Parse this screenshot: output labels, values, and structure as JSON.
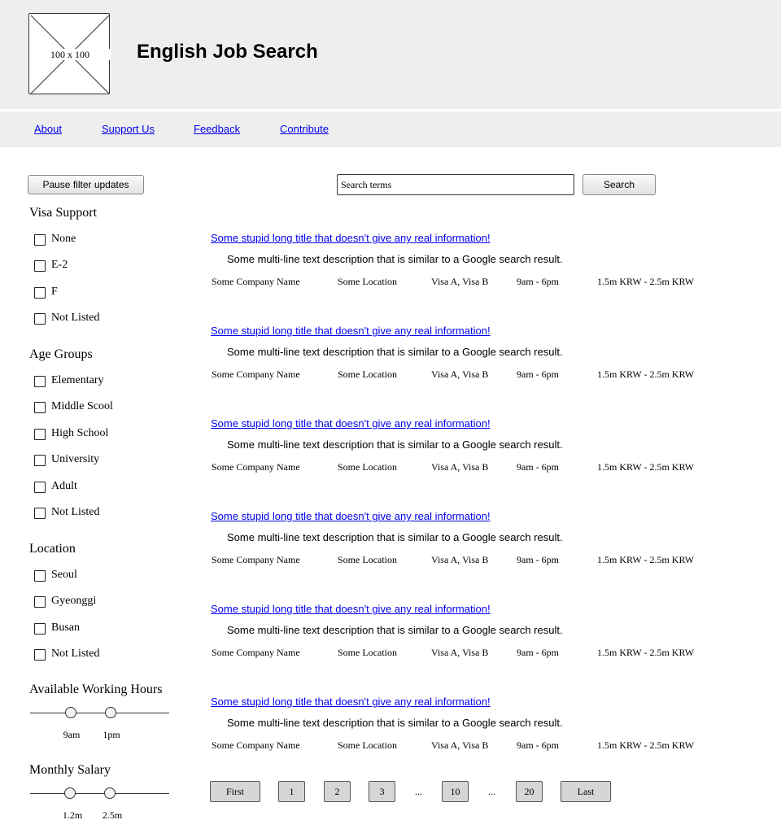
{
  "header": {
    "logo_placeholder": "100 x 100",
    "title": "English Job Search"
  },
  "nav": {
    "links": [
      "About",
      "Support Us",
      "Feedback",
      "Contribute"
    ]
  },
  "sidebar": {
    "pause_button": "Pause filter updates",
    "visa": {
      "title": "Visa Support",
      "options": [
        "None",
        "E-2",
        "F",
        "Not Listed"
      ]
    },
    "age": {
      "title": "Age Groups",
      "options": [
        "Elementary",
        "Middle Scool",
        "High School",
        "University",
        "Adult",
        "Not Listed"
      ]
    },
    "location": {
      "title": "Location",
      "options": [
        "Seoul",
        "Gyeonggi",
        "Busan",
        "Not Listed"
      ]
    },
    "hours": {
      "title": "Available Working Hours",
      "low_label": "9am",
      "high_label": "1pm"
    },
    "salary": {
      "title": "Monthly Salary",
      "low_label": "1.2m",
      "high_label": "2.5m"
    }
  },
  "search": {
    "value": "Search terms",
    "button": "Search"
  },
  "results": [
    {
      "title": "Some stupid long title that doesn't give any real information!",
      "description": "Some multi-line text description that is similar to a Google search result.",
      "company": "Some Company Name",
      "location": "Some Location",
      "visa": "Visa A, Visa B",
      "hours": "9am - 6pm",
      "salary": "1.5m KRW - 2.5m KRW"
    },
    {
      "title": "Some stupid long title that doesn't give any real information!",
      "description": "Some multi-line text description that is similar to a Google search result.",
      "company": "Some Company Name",
      "location": "Some Location",
      "visa": "Visa A, Visa B",
      "hours": "9am - 6pm",
      "salary": "1.5m KRW - 2.5m KRW"
    },
    {
      "title": "Some stupid long title that doesn't give any real information!",
      "description": "Some multi-line text description that is similar to a Google search result.",
      "company": "Some Company Name",
      "location": "Some Location",
      "visa": "Visa A, Visa B",
      "hours": "9am - 6pm",
      "salary": "1.5m KRW - 2.5m KRW"
    },
    {
      "title": "Some stupid long title that doesn't give any real information!",
      "description": "Some multi-line text description that is similar to a Google search result.",
      "company": "Some Company Name",
      "location": "Some Location",
      "visa": "Visa A, Visa B",
      "hours": "9am - 6pm",
      "salary": "1.5m KRW - 2.5m KRW"
    },
    {
      "title": "Some stupid long title that doesn't give any real information!",
      "description": "Some multi-line text description that is similar to a Google search result.",
      "company": "Some Company Name",
      "location": "Some Location",
      "visa": "Visa A, Visa B",
      "hours": "9am - 6pm",
      "salary": "1.5m KRW - 2.5m KRW"
    },
    {
      "title": "Some stupid long title that doesn't give any real information!",
      "description": "Some multi-line text description that is similar to a Google search result.",
      "company": "Some Company Name",
      "location": "Some Location",
      "visa": "Visa A, Visa B",
      "hours": "9am - 6pm",
      "salary": "1.5m KRW - 2.5m KRW"
    }
  ],
  "pagination": {
    "first": "First",
    "pages": [
      "1",
      "2",
      "3"
    ],
    "ellipsis": "...",
    "page_10": "10",
    "page_20": "20",
    "last": "Last"
  }
}
